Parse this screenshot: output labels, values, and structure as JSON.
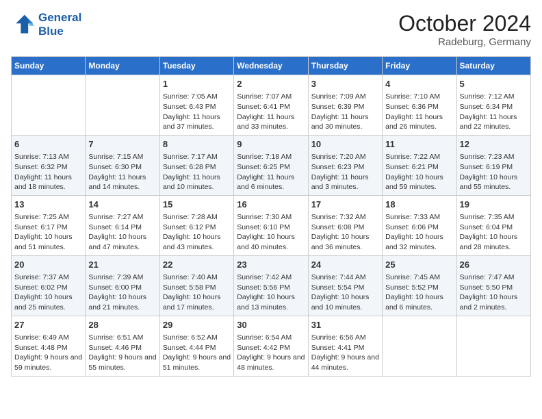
{
  "header": {
    "logo_line1": "General",
    "logo_line2": "Blue",
    "month": "October 2024",
    "location": "Radeburg, Germany"
  },
  "weekdays": [
    "Sunday",
    "Monday",
    "Tuesday",
    "Wednesday",
    "Thursday",
    "Friday",
    "Saturday"
  ],
  "weeks": [
    [
      {
        "day": "",
        "sunrise": "",
        "sunset": "",
        "daylight": ""
      },
      {
        "day": "",
        "sunrise": "",
        "sunset": "",
        "daylight": ""
      },
      {
        "day": "1",
        "sunrise": "Sunrise: 7:05 AM",
        "sunset": "Sunset: 6:43 PM",
        "daylight": "Daylight: 11 hours and 37 minutes."
      },
      {
        "day": "2",
        "sunrise": "Sunrise: 7:07 AM",
        "sunset": "Sunset: 6:41 PM",
        "daylight": "Daylight: 11 hours and 33 minutes."
      },
      {
        "day": "3",
        "sunrise": "Sunrise: 7:09 AM",
        "sunset": "Sunset: 6:39 PM",
        "daylight": "Daylight: 11 hours and 30 minutes."
      },
      {
        "day": "4",
        "sunrise": "Sunrise: 7:10 AM",
        "sunset": "Sunset: 6:36 PM",
        "daylight": "Daylight: 11 hours and 26 minutes."
      },
      {
        "day": "5",
        "sunrise": "Sunrise: 7:12 AM",
        "sunset": "Sunset: 6:34 PM",
        "daylight": "Daylight: 11 hours and 22 minutes."
      }
    ],
    [
      {
        "day": "6",
        "sunrise": "Sunrise: 7:13 AM",
        "sunset": "Sunset: 6:32 PM",
        "daylight": "Daylight: 11 hours and 18 minutes."
      },
      {
        "day": "7",
        "sunrise": "Sunrise: 7:15 AM",
        "sunset": "Sunset: 6:30 PM",
        "daylight": "Daylight: 11 hours and 14 minutes."
      },
      {
        "day": "8",
        "sunrise": "Sunrise: 7:17 AM",
        "sunset": "Sunset: 6:28 PM",
        "daylight": "Daylight: 11 hours and 10 minutes."
      },
      {
        "day": "9",
        "sunrise": "Sunrise: 7:18 AM",
        "sunset": "Sunset: 6:25 PM",
        "daylight": "Daylight: 11 hours and 6 minutes."
      },
      {
        "day": "10",
        "sunrise": "Sunrise: 7:20 AM",
        "sunset": "Sunset: 6:23 PM",
        "daylight": "Daylight: 11 hours and 3 minutes."
      },
      {
        "day": "11",
        "sunrise": "Sunrise: 7:22 AM",
        "sunset": "Sunset: 6:21 PM",
        "daylight": "Daylight: 10 hours and 59 minutes."
      },
      {
        "day": "12",
        "sunrise": "Sunrise: 7:23 AM",
        "sunset": "Sunset: 6:19 PM",
        "daylight": "Daylight: 10 hours and 55 minutes."
      }
    ],
    [
      {
        "day": "13",
        "sunrise": "Sunrise: 7:25 AM",
        "sunset": "Sunset: 6:17 PM",
        "daylight": "Daylight: 10 hours and 51 minutes."
      },
      {
        "day": "14",
        "sunrise": "Sunrise: 7:27 AM",
        "sunset": "Sunset: 6:14 PM",
        "daylight": "Daylight: 10 hours and 47 minutes."
      },
      {
        "day": "15",
        "sunrise": "Sunrise: 7:28 AM",
        "sunset": "Sunset: 6:12 PM",
        "daylight": "Daylight: 10 hours and 43 minutes."
      },
      {
        "day": "16",
        "sunrise": "Sunrise: 7:30 AM",
        "sunset": "Sunset: 6:10 PM",
        "daylight": "Daylight: 10 hours and 40 minutes."
      },
      {
        "day": "17",
        "sunrise": "Sunrise: 7:32 AM",
        "sunset": "Sunset: 6:08 PM",
        "daylight": "Daylight: 10 hours and 36 minutes."
      },
      {
        "day": "18",
        "sunrise": "Sunrise: 7:33 AM",
        "sunset": "Sunset: 6:06 PM",
        "daylight": "Daylight: 10 hours and 32 minutes."
      },
      {
        "day": "19",
        "sunrise": "Sunrise: 7:35 AM",
        "sunset": "Sunset: 6:04 PM",
        "daylight": "Daylight: 10 hours and 28 minutes."
      }
    ],
    [
      {
        "day": "20",
        "sunrise": "Sunrise: 7:37 AM",
        "sunset": "Sunset: 6:02 PM",
        "daylight": "Daylight: 10 hours and 25 minutes."
      },
      {
        "day": "21",
        "sunrise": "Sunrise: 7:39 AM",
        "sunset": "Sunset: 6:00 PM",
        "daylight": "Daylight: 10 hours and 21 minutes."
      },
      {
        "day": "22",
        "sunrise": "Sunrise: 7:40 AM",
        "sunset": "Sunset: 5:58 PM",
        "daylight": "Daylight: 10 hours and 17 minutes."
      },
      {
        "day": "23",
        "sunrise": "Sunrise: 7:42 AM",
        "sunset": "Sunset: 5:56 PM",
        "daylight": "Daylight: 10 hours and 13 minutes."
      },
      {
        "day": "24",
        "sunrise": "Sunrise: 7:44 AM",
        "sunset": "Sunset: 5:54 PM",
        "daylight": "Daylight: 10 hours and 10 minutes."
      },
      {
        "day": "25",
        "sunrise": "Sunrise: 7:45 AM",
        "sunset": "Sunset: 5:52 PM",
        "daylight": "Daylight: 10 hours and 6 minutes."
      },
      {
        "day": "26",
        "sunrise": "Sunrise: 7:47 AM",
        "sunset": "Sunset: 5:50 PM",
        "daylight": "Daylight: 10 hours and 2 minutes."
      }
    ],
    [
      {
        "day": "27",
        "sunrise": "Sunrise: 6:49 AM",
        "sunset": "Sunset: 4:48 PM",
        "daylight": "Daylight: 9 hours and 59 minutes."
      },
      {
        "day": "28",
        "sunrise": "Sunrise: 6:51 AM",
        "sunset": "Sunset: 4:46 PM",
        "daylight": "Daylight: 9 hours and 55 minutes."
      },
      {
        "day": "29",
        "sunrise": "Sunrise: 6:52 AM",
        "sunset": "Sunset: 4:44 PM",
        "daylight": "Daylight: 9 hours and 51 minutes."
      },
      {
        "day": "30",
        "sunrise": "Sunrise: 6:54 AM",
        "sunset": "Sunset: 4:42 PM",
        "daylight": "Daylight: 9 hours and 48 minutes."
      },
      {
        "day": "31",
        "sunrise": "Sunrise: 6:56 AM",
        "sunset": "Sunset: 4:41 PM",
        "daylight": "Daylight: 9 hours and 44 minutes."
      },
      {
        "day": "",
        "sunrise": "",
        "sunset": "",
        "daylight": ""
      },
      {
        "day": "",
        "sunrise": "",
        "sunset": "",
        "daylight": ""
      }
    ]
  ]
}
